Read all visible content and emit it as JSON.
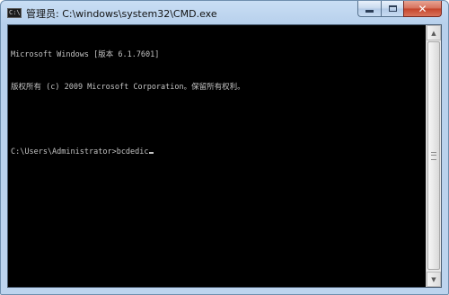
{
  "window": {
    "title": "管理员: C:\\windows\\system32\\CMD.exe",
    "app_icon_glyph": "C:\\",
    "caption_buttons": {
      "minimize_icon": "minimize-icon",
      "maximize_icon": "maximize-icon",
      "close_glyph": "✕"
    }
  },
  "console": {
    "lines": [
      "Microsoft Windows [版本 6.1.7601]",
      "版权所有 (c) 2009 Microsoft Corporation。保留所有权利。",
      "",
      "C:\\Users\\Administrator>bcdedic"
    ],
    "text_color": "#c3c3c3",
    "background_color": "#000000"
  },
  "scrollbar": {
    "up_arrow": "▲",
    "down_arrow": "▼"
  }
}
